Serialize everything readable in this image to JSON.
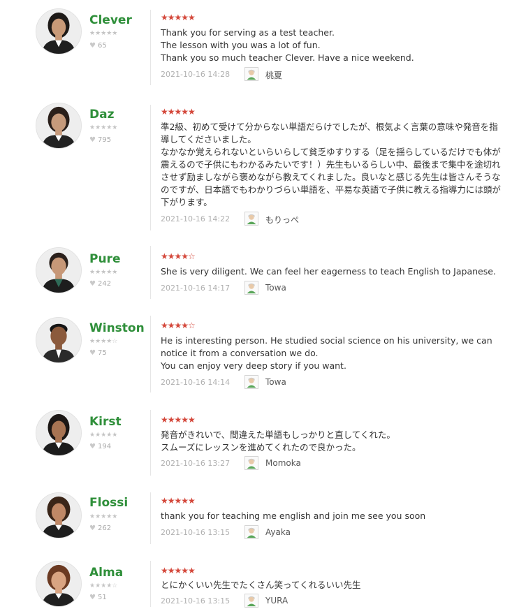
{
  "reviews": [
    {
      "teacher": "Clever",
      "teacher_stars": "★★★★★",
      "likes": "65",
      "rating": "★★★★★",
      "comment": "Thank you for serving as a test teacher.\nThe lesson with you was a lot of fun.\nThank you so much teacher Clever. Have a nice weekend.",
      "date": "2021-10-16 14:28",
      "user": "桃夏"
    },
    {
      "teacher": "Daz",
      "teacher_stars": "★★★★★",
      "likes": "795",
      "rating": "★★★★★",
      "comment": "準2級、初めて受けて分からない単語だらけでしたが、根気よく言葉の意味や発音を指導してくださいました。\nなかなか覚えられないといらいらして貧乏ゆすりする（足を揺らしているだけでも体が震えるので子供にもわかるみたいです！）先生もいるらしい中、最後まで集中を途切れさせず励ましながら褒めながら教えてくれました。良いなと感じる先生は皆さんそうなのですが、日本語でもわかりづらい単語を、平易な英語で子供に教える指導力には頭が下がります。",
      "date": "2021-10-16 14:22",
      "user": "もりっぺ"
    },
    {
      "teacher": "Pure",
      "teacher_stars": "★★★★★",
      "likes": "242",
      "rating": "★★★★☆",
      "comment": "She is very diligent. We can feel her eagerness to teach English to Japanese.",
      "date": "2021-10-16 14:17",
      "user": "Towa"
    },
    {
      "teacher": "Winston",
      "teacher_stars": "★★★★☆",
      "likes": "75",
      "rating": "★★★★☆",
      "comment": "He is interesting person. He studied social science on his university, we can notice it from a conversation we do.\nYou can enjoy very deep story if you want.",
      "date": "2021-10-16 14:14",
      "user": "Towa"
    },
    {
      "teacher": "Kirst",
      "teacher_stars": "★★★★★",
      "likes": "194",
      "rating": "★★★★★",
      "comment": "発音がきれいで、間違えた単語もしっかりと直してくれた。\nスムーズにレッスンを進めてくれたので良かった。",
      "date": "2021-10-16 13:27",
      "user": "Momoka"
    },
    {
      "teacher": "Flossi",
      "teacher_stars": "★★★★★",
      "likes": "262",
      "rating": "★★★★★",
      "comment": "thank you for teaching me english and join me see you soon",
      "date": "2021-10-16 13:15",
      "user": "Ayaka"
    },
    {
      "teacher": "Alma",
      "teacher_stars": "★★★★☆",
      "likes": "51",
      "rating": "★★★★★",
      "comment": "とにかくいい先生でたくさん笑ってくれるいい先生",
      "date": "2021-10-16 13:15",
      "user": "YURA"
    }
  ],
  "icons": {
    "heart": "heart-icon",
    "user": "user-avatar-icon"
  },
  "colors": {
    "teacher_name": "#2f8f3a",
    "rating_star": "#d4473a",
    "muted_text": "#b0b0b0"
  }
}
